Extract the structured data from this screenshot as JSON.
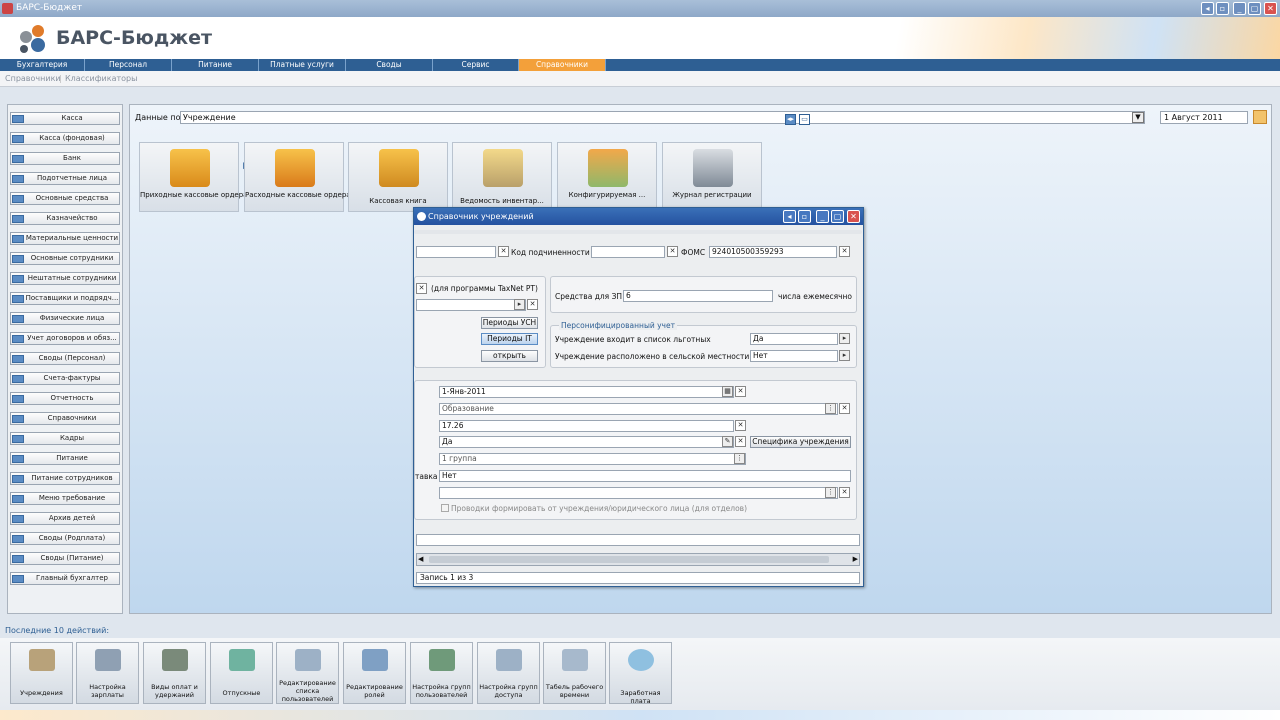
{
  "window": {
    "title": "БАРС-Бюджет"
  },
  "logo": {
    "text": "БАРС-Бюджет"
  },
  "menu": [
    "Бухгалтерия",
    "Персонал",
    "Питание",
    "Платные услуги",
    "Своды",
    "Сервис",
    "Справочники"
  ],
  "submenu": [
    "Справочники",
    "Классификаторы"
  ],
  "sidebar": [
    "Касса",
    "Касса (фондовая)",
    "Банк",
    "Подотчетные лица",
    "Основные средства",
    "Казначейство",
    "Материальные ценности",
    "Основные сотрудники",
    "Нештатные сотрудники",
    "Поставщики и подрядч...",
    "Физические лица",
    "Учет договоров и обяз...",
    "Своды (Персонал)",
    "Счета-фактуры",
    "Отчетность",
    "Справочники",
    "Кадры",
    "Питание",
    "Питание сотрудников",
    "Меню требование",
    "Архив детей",
    "Своды (Родплата)",
    "Своды (Питание)",
    "Главный бухгалтер"
  ],
  "filter": {
    "label": "Данные по",
    "value": "Учреждение",
    "date": "1 Август 2011"
  },
  "tiles": [
    "Приходные кассовые ордера",
    "Расходные кассовые ордера",
    "Кассовая книга",
    "Ведомость инвентар...",
    "Конфигурируемая ...",
    "Журнал регистрации"
  ],
  "dialog": {
    "title": "Справочник учреждений",
    "kod_label": "Код подчиненности",
    "foms_label": "ФОМС",
    "foms_value": "924010500359293",
    "taxnet_label": "(для программы TaxNet PT)",
    "btn_usn": "Периоды УСН",
    "btn_it": "Периоды IT",
    "btn_open": "открыть",
    "zp_label": "Средства для ЗП",
    "zp_value": "6",
    "zp_suffix": "числа ежемесячно",
    "pers_title": "Персонифицированный учет",
    "lgot_label": "Учреждение входит в список льготных",
    "lgot_value": "Да",
    "selsk_label": "Учреждение расположено в сельской местности",
    "selsk_value": "Нет",
    "date_value": "1-Янв-2011",
    "field2": "Образование",
    "field3": "17.26",
    "field4": "Да",
    "btn_spec": "Специфика учреждения",
    "field5": "1 группа",
    "stavk_label": "тавка",
    "field6": "Нет",
    "chk_label": "Проводки формировать от учреждения/юридического лица (для отделов)",
    "status": "Запись 1 из 3"
  },
  "recent": {
    "label": "Последние 10 действий:",
    "items": [
      "Учреждения",
      "Настройка зарплаты",
      "Виды оплат и удержаний",
      "Отпускные",
      "Редактирование списка пользователей",
      "Редактирование ролей",
      "Настройка групп пользователей",
      "Настройка групп доступа",
      "Табель рабочего времени",
      "Заработная плата"
    ]
  }
}
